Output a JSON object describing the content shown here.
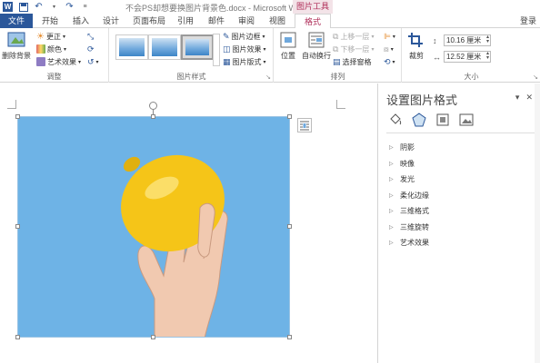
{
  "window": {
    "title": "不会PS却想要换图片背景色.docx - Microsoft Word",
    "context_tool": "图片工具"
  },
  "tabs": [
    {
      "label": "文件"
    },
    {
      "label": "开始"
    },
    {
      "label": "插入"
    },
    {
      "label": "设计"
    },
    {
      "label": "页面布局"
    },
    {
      "label": "引用"
    },
    {
      "label": "邮件"
    },
    {
      "label": "审阅"
    },
    {
      "label": "视图"
    },
    {
      "label": "格式"
    }
  ],
  "login": "登录",
  "ribbon": {
    "adjust": {
      "remove_bg": "删除背景",
      "corrections": "更正",
      "color": "颜色",
      "artistic": "艺术效果",
      "label": "调整"
    },
    "styles": {
      "border": "图片边框",
      "effects": "图片效果",
      "layout": "图片版式",
      "label": "图片样式"
    },
    "arrange": {
      "position": "位置",
      "wrap": "自动换行",
      "forward": "上移一层",
      "backward": "下移一层",
      "selection": "选择窗格",
      "label": "排列"
    },
    "size": {
      "crop": "裁剪",
      "height": "10.16 厘米",
      "width": "12.52 厘米",
      "label": "大小"
    }
  },
  "pane": {
    "title": "设置图片格式",
    "items": [
      {
        "label": "阴影"
      },
      {
        "label": "映像"
      },
      {
        "label": "发光"
      },
      {
        "label": "柔化边缘"
      },
      {
        "label": "三维格式"
      },
      {
        "label": "三维旋转"
      },
      {
        "label": "艺术效果"
      }
    ]
  },
  "colors": {
    "word_blue": "#2b579a",
    "format_accent": "#b02f5a",
    "photo_bg": "#6eb3e6",
    "lemon": "#f5c518"
  }
}
